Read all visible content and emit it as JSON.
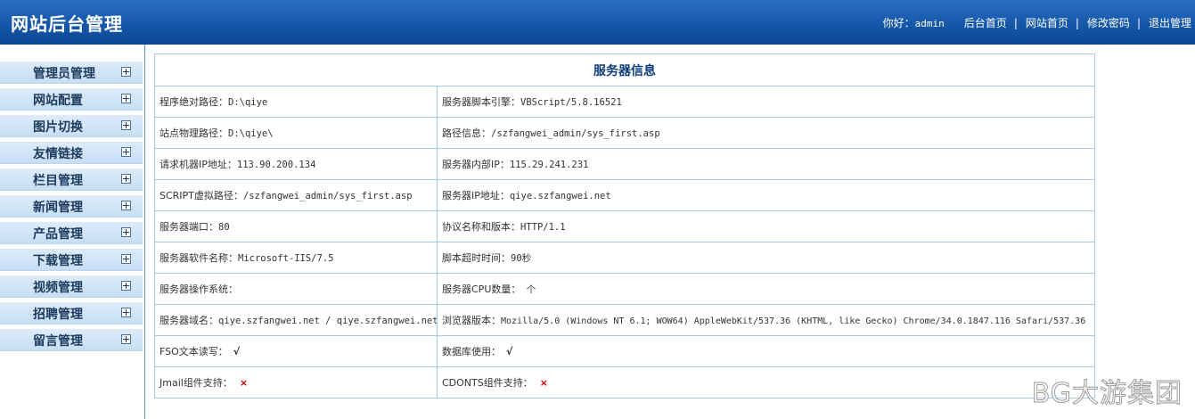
{
  "header": {
    "title": "网站后台管理",
    "greeting": "你好：",
    "username": "admin",
    "links": [
      "后台首页",
      "网站首页",
      "修改密码",
      "退出管理"
    ],
    "separator": "|"
  },
  "sidebar": {
    "items": [
      {
        "label": "管理员管理"
      },
      {
        "label": "网站配置"
      },
      {
        "label": "图片切换"
      },
      {
        "label": "友情链接"
      },
      {
        "label": "栏目管理"
      },
      {
        "label": "新闻管理"
      },
      {
        "label": "产品管理"
      },
      {
        "label": "下载管理"
      },
      {
        "label": "视频管理"
      },
      {
        "label": "招聘管理"
      },
      {
        "label": "留言管理"
      }
    ],
    "expand_icon": "plus-box-icon"
  },
  "server_info": {
    "title": "服务器信息",
    "rows": [
      [
        {
          "label": "程序绝对路径：",
          "value": "D:\\qiye"
        },
        {
          "label": "服务器脚本引擎：",
          "value": "VBScript/5.8.16521"
        }
      ],
      [
        {
          "label": "站点物理路径：",
          "value": "D:\\qiye\\"
        },
        {
          "label": "路径信息：",
          "value": "/szfangwei_admin/sys_first.asp"
        }
      ],
      [
        {
          "label": "请求机器IP地址：",
          "value": "113.90.200.134"
        },
        {
          "label": "服务器内部IP：",
          "value": "115.29.241.231"
        }
      ],
      [
        {
          "label": "SCRIPT虚拟路径：",
          "value": "/szfangwei_admin/sys_first.asp"
        },
        {
          "label": "服务器IP地址：",
          "value": "qiye.szfangwei.net"
        }
      ],
      [
        {
          "label": "服务器端口：",
          "value": "80"
        },
        {
          "label": "协议名称和版本：",
          "value": "HTTP/1.1"
        }
      ],
      [
        {
          "label": "服务器软件名称：",
          "value": "Microsoft-IIS/7.5"
        },
        {
          "label": "脚本超时时间：",
          "value": "90秒"
        }
      ],
      [
        {
          "label": "服务器操作系统：",
          "value": ""
        },
        {
          "label": "服务器CPU数量：",
          "value": " 个"
        }
      ],
      [
        {
          "label": "服务器域名：",
          "value": "qiye.szfangwei.net / qiye.szfangwei.net"
        },
        {
          "label": "浏览器版本：",
          "value": "Mozilla/5.0 (Windows NT 6.1; WOW64) AppleWebKit/537.36 (KHTML, like Gecko) Chrome/34.0.1847.116 Safari/537.36"
        }
      ]
    ],
    "fso": {
      "label": "FSO文本读写：",
      "mark": "√"
    },
    "db": {
      "label": "数据库使用：",
      "mark": "√"
    },
    "jmail": {
      "label": "Jmail组件支持：",
      "mark": "×"
    },
    "cdonts": {
      "label": "CDONTS组件支持：",
      "mark": "×"
    }
  },
  "colors": {
    "header_blue": "#1557a8",
    "menu_bg": "#c6def4",
    "table_border": "#a8c8e6",
    "title_text": "#0f3d7a",
    "cross_red": "#d40000"
  },
  "watermark": "BG大游集团"
}
